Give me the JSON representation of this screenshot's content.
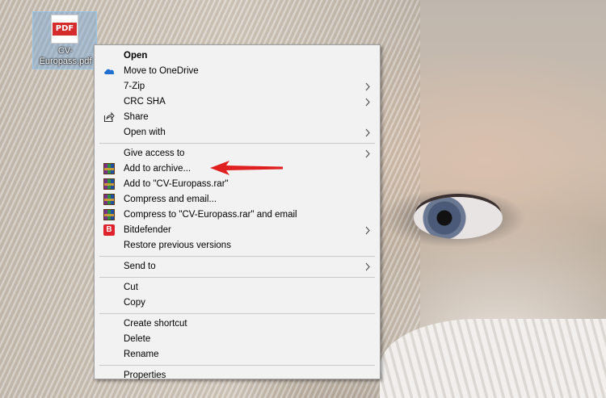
{
  "desktop": {
    "file_icon": {
      "badge": "PDF",
      "name": "CV-Europass.pdf",
      "icon": "pdf-file-icon"
    }
  },
  "context_menu": {
    "items": [
      {
        "label": "Open",
        "bold": true
      },
      {
        "label": "Move to OneDrive",
        "icon": "onedrive-cloud-icon"
      },
      {
        "label": "7-Zip",
        "submenu": true
      },
      {
        "label": "CRC SHA",
        "submenu": true
      },
      {
        "label": "Share",
        "icon": "share-icon"
      },
      {
        "label": "Open with",
        "submenu": true
      },
      {
        "label": "Give access to",
        "submenu": true
      },
      {
        "label": "Add to archive...",
        "icon": "winrar-icon"
      },
      {
        "label": "Add to \"CV-Europass.rar\"",
        "icon": "winrar-icon"
      },
      {
        "label": "Compress and email...",
        "icon": "winrar-icon"
      },
      {
        "label": "Compress to \"CV-Europass.rar\" and email",
        "icon": "winrar-icon"
      },
      {
        "label": "Bitdefender",
        "icon": "bitdefender-icon",
        "icon_text": "B",
        "submenu": true
      },
      {
        "label": "Restore previous versions"
      },
      {
        "label": "Send to",
        "submenu": true
      },
      {
        "label": "Cut"
      },
      {
        "label": "Copy"
      },
      {
        "label": "Create shortcut"
      },
      {
        "label": "Delete"
      },
      {
        "label": "Rename"
      },
      {
        "label": "Properties"
      }
    ]
  },
  "annotation": {
    "icon": "red-pointer-arrow",
    "color": "#e02020"
  },
  "colors": {
    "menu_bg": "#f2f2f2",
    "onedrive_blue": "#1e6fd0",
    "pdf_red": "#d52b2b"
  }
}
